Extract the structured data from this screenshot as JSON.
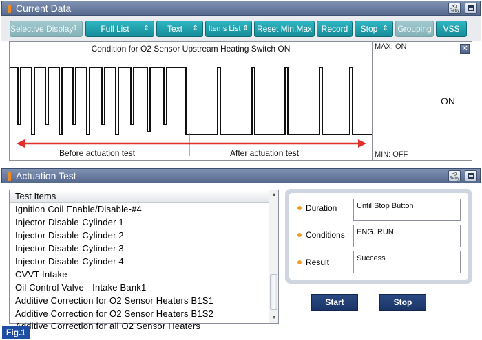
{
  "current_data_panel": {
    "title": "Current Data"
  },
  "toolbar": {
    "selective_display": "Selective Display",
    "full_list": "Full List",
    "text": "Text",
    "items_list": "Items List",
    "reset_minmax": "Reset Min.Max",
    "record": "Record",
    "stop": "Stop",
    "grouping": "Grouping",
    "vss": "VSS"
  },
  "graph": {
    "title": "Condition for O2 Sensor Upstream Heating Switch ON",
    "max_label": "MAX: ON",
    "min_label": "MIN: OFF",
    "current_value": "ON",
    "before_label": "Before actuation test",
    "after_label": "After actuation test",
    "line_color": "#111111",
    "arrow_color": "#e0302c"
  },
  "actuation_panel": {
    "title": "Actuation Test"
  },
  "test_list": {
    "header": "Test Items",
    "items": [
      "Ignition Coil Enable/Disable-#4",
      "Injector Disable-Cylinder 1",
      "Injector Disable-Cylinder 2",
      "Injector Disable-Cylinder 3",
      "Injector Disable-Cylinder 4",
      "CVVT Intake",
      "Oil Control Valve - Intake Bank1",
      "Additive Correction for O2 Sensor Heaters B1S1",
      "Additive Correction for O2 Sensor Heaters B1S2",
      "Additive Correction for all O2 Sensor Heaters"
    ],
    "selected_index": 8
  },
  "info": {
    "duration_label": "Duration",
    "duration_value": "Until Stop Button",
    "conditions_label": "Conditions",
    "conditions_value": "ENG. RUN",
    "result_label": "Result",
    "result_value": "Success"
  },
  "actions": {
    "start": "Start",
    "stop": "Stop"
  },
  "figure_label": "Fig.1",
  "header_buttons": {
    "retry": "Retry"
  }
}
